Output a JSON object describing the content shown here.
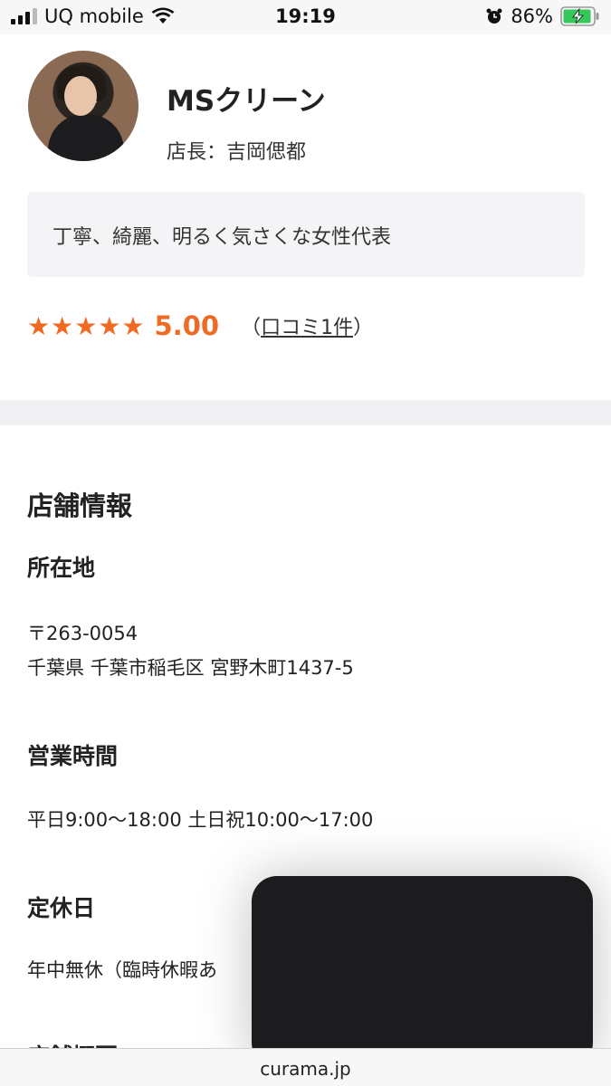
{
  "status_bar": {
    "carrier": "UQ mobile",
    "time": "19:19",
    "battery_percent": "86%"
  },
  "profile": {
    "shop_name": "MSクリーン",
    "manager": "店長：吉岡偲都",
    "catchphrase": "丁寧、綺麗、明るく気さくな女性代表",
    "stars": "★★★★★",
    "rating": "5.00",
    "review_open": "（",
    "review_link": "口コミ1件",
    "review_close": "）"
  },
  "store_info": {
    "title": "店舗情報",
    "address_heading": "所在地",
    "postal_code": "〒263-0054",
    "address": "千葉県 千葉市稲毛区 宮野木町1437-5",
    "hours_heading": "営業時間",
    "hours": "平日9:00〜18:00 土日祝10:00〜17:00",
    "holiday_heading": "定休日",
    "holiday": "年中無休（臨時休暇あ",
    "overview_heading": "店舗概要"
  },
  "browser": {
    "url": "curama.jp"
  },
  "colors": {
    "accent": "#ef6a22",
    "catch_bg": "#f4f4f6",
    "overlay": "#1c1c1e"
  }
}
